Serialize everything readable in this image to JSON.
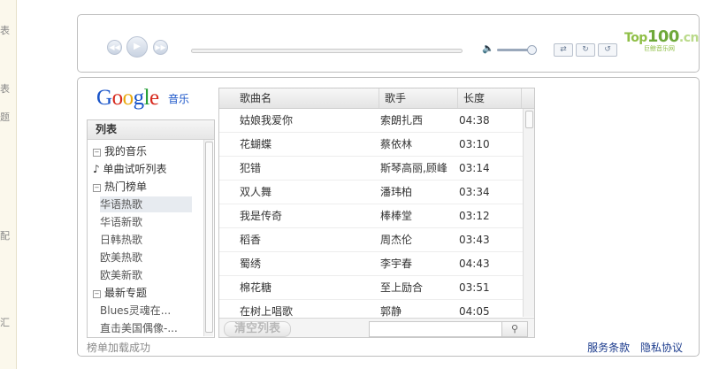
{
  "left_strip": {
    "chars": [
      "表",
      "表",
      "题",
      "配",
      "汇"
    ]
  },
  "player": {
    "prev_icon": "prev-track-icon",
    "play_icon": "play-icon",
    "next_icon": "next-track-icon",
    "volume_icon": "speaker-icon",
    "volume_level": 0.85,
    "progress": 0,
    "logo": {
      "text_a": "Top",
      "text_b": "100",
      "text_c": ".cn",
      "sub": "巨鲸音乐网"
    }
  },
  "panel": {
    "logo_text": "Google",
    "logo_sub": "音乐",
    "sidebar": {
      "header": "列表",
      "items": [
        {
          "label": "我的音乐",
          "type": "group"
        },
        {
          "label": "单曲试听列表",
          "type": "note"
        },
        {
          "label": "热门榜单",
          "type": "group"
        },
        {
          "label": "华语热歌",
          "type": "sub",
          "selected": true
        },
        {
          "label": "华语新歌",
          "type": "sub"
        },
        {
          "label": "日韩热歌",
          "type": "sub"
        },
        {
          "label": "欧美热歌",
          "type": "sub"
        },
        {
          "label": "欧美新歌",
          "type": "sub"
        },
        {
          "label": "最新专题",
          "type": "group"
        },
        {
          "label": "Blues灵魂在...",
          "type": "sub"
        },
        {
          "label": "直击美国偶像-...",
          "type": "sub"
        }
      ]
    },
    "table": {
      "columns": [
        "歌曲名",
        "歌手",
        "长度"
      ],
      "rows": [
        [
          "姑娘我爱你",
          "索朗扎西",
          "04:38"
        ],
        [
          "花蝴蝶",
          "蔡依林",
          "03:10"
        ],
        [
          "犯错",
          "斯琴高丽,顾峰",
          "03:14"
        ],
        [
          "双人舞",
          "潘玮柏",
          "03:34"
        ],
        [
          "我是传奇",
          "棒棒堂",
          "03:12"
        ],
        [
          "稻香",
          "周杰伦",
          "03:43"
        ],
        [
          "蜀绣",
          "李宇春",
          "04:43"
        ],
        [
          "棉花糖",
          "至上励合",
          "03:51"
        ],
        [
          "在树上唱歌",
          "郭静",
          "04:05"
        ]
      ],
      "clear_label": "清空列表",
      "search_placeholder": "",
      "search_icon": "magnifier-icon"
    },
    "status": "榜单加载成功",
    "footer_links": [
      "服务条款",
      "隐私协议"
    ]
  }
}
